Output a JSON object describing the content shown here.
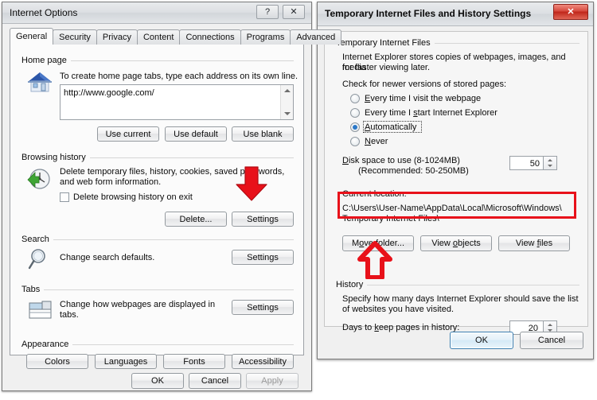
{
  "internet_options": {
    "title": "Internet Options",
    "caption_buttons": [
      {
        "name": "help-button",
        "glyph": "?"
      },
      {
        "name": "close-button",
        "glyph": "✕"
      }
    ],
    "tabs": [
      {
        "label": "General",
        "active": true
      },
      {
        "label": "Security",
        "active": false
      },
      {
        "label": "Privacy",
        "active": false
      },
      {
        "label": "Content",
        "active": false
      },
      {
        "label": "Connections",
        "active": false
      },
      {
        "label": "Programs",
        "active": false
      },
      {
        "label": "Advanced",
        "active": false
      }
    ],
    "home_page": {
      "group_title": "Home page",
      "icon": "home-icon",
      "description": "To create home page tabs, type each address on its own line.",
      "address_value": "http://www.google.com/",
      "buttons": [
        "Use current",
        "Use default",
        "Use blank"
      ]
    },
    "browsing_history": {
      "group_title": "Browsing history",
      "icon": "history-icon",
      "description_line1": "Delete temporary files, history, cookies, saved passwords,",
      "description_line2": "and web form information.",
      "checkbox_label": "Delete browsing history on exit",
      "checkbox_checked": false,
      "buttons": [
        "Delete...",
        "Settings"
      ]
    },
    "search": {
      "group_title": "Search",
      "icon": "magnifier-icon",
      "description": "Change search defaults.",
      "button": "Settings"
    },
    "tabs_section": {
      "group_title": "Tabs",
      "icon": "tabs-icon",
      "description_line1": "Change how webpages are displayed in",
      "description_line2": "tabs.",
      "button": "Settings"
    },
    "appearance": {
      "group_title": "Appearance",
      "buttons": [
        "Colors",
        "Languages",
        "Fonts",
        "Accessibility"
      ]
    },
    "footer_buttons": [
      {
        "label": "OK",
        "disabled": false
      },
      {
        "label": "Cancel",
        "disabled": false
      },
      {
        "label": "Apply",
        "disabled": true
      }
    ]
  },
  "temp_files_dialog": {
    "title": "Temporary Internet Files and History Settings",
    "close_glyph": "✕",
    "temporary_internet_files": {
      "group_title": "Temporary Internet Files",
      "description_line1": "Internet Explorer stores copies of webpages, images, and media",
      "description_line2": "for faster viewing later.",
      "check_label": "Check for newer versions of stored pages:",
      "radios": [
        {
          "label_pre": "",
          "label_underline": "E",
          "label_post": "very time I visit the webpage",
          "checked": false
        },
        {
          "label_pre": "Every time I ",
          "label_underline": "s",
          "label_post": "tart Internet Explorer",
          "checked": false
        },
        {
          "label_pre": "",
          "label_underline": "A",
          "label_post": "utomatically",
          "checked": true,
          "focused": true
        },
        {
          "label_pre": "",
          "label_underline": "N",
          "label_post": "ever",
          "checked": false
        }
      ],
      "disk_space_label_pre": "",
      "disk_space_label_underline": "D",
      "disk_space_label_post": "isk space to use (8-1024MB)",
      "disk_space_recommended": "(Recommended: 50-250MB)",
      "disk_space_value": "50",
      "current_location_label": "Current location:",
      "current_location_line1": "C:\\Users\\User-Name\\AppData\\Local\\Microsoft\\Windows\\",
      "current_location_line2": "Temporary Internet Files\\",
      "buttons": [
        {
          "label_pre": "M",
          "label_underline": "o",
          "label_post": "ve folder..."
        },
        {
          "label_pre": "View ",
          "label_underline": "o",
          "label_post": "bjects"
        },
        {
          "label_pre": "View ",
          "label_underline": "f",
          "label_post": "iles"
        }
      ]
    },
    "history": {
      "group_title": "History",
      "description_line1": "Specify how many days Internet Explorer should save the list",
      "description_line2": "of websites you have visited.",
      "days_label_pre": "Days to ",
      "days_label_underline": "k",
      "days_label_post": "eep pages in history:",
      "days_value": "20"
    },
    "footer_buttons": [
      {
        "label": "OK",
        "default": true
      },
      {
        "label": "Cancel",
        "default": false
      }
    ]
  },
  "annotations": {
    "highlight_color": "#e8111a",
    "down_arrow_name": "red-down-arrow-annotation",
    "up_arrow_name": "red-up-arrow-annotation",
    "location_highlight_name": "red-highlight-box-annotation"
  }
}
